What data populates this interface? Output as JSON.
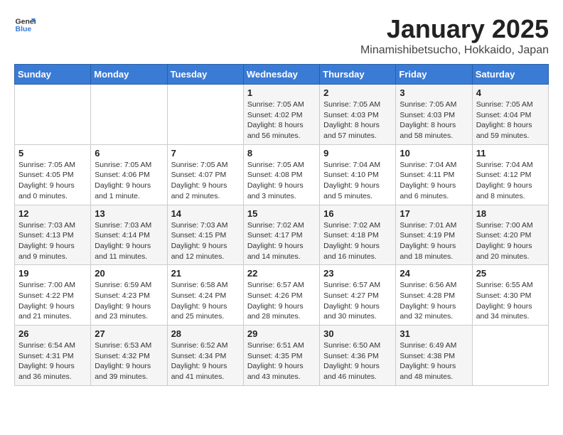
{
  "logo": {
    "line1": "General",
    "line2": "Blue"
  },
  "title": "January 2025",
  "subtitle": "Minamishibetsucho, Hokkaido, Japan",
  "weekdays": [
    "Sunday",
    "Monday",
    "Tuesday",
    "Wednesday",
    "Thursday",
    "Friday",
    "Saturday"
  ],
  "weeks": [
    [
      {
        "day": "",
        "info": ""
      },
      {
        "day": "",
        "info": ""
      },
      {
        "day": "",
        "info": ""
      },
      {
        "day": "1",
        "info": "Sunrise: 7:05 AM\nSunset: 4:02 PM\nDaylight: 8 hours\nand 56 minutes."
      },
      {
        "day": "2",
        "info": "Sunrise: 7:05 AM\nSunset: 4:03 PM\nDaylight: 8 hours\nand 57 minutes."
      },
      {
        "day": "3",
        "info": "Sunrise: 7:05 AM\nSunset: 4:03 PM\nDaylight: 8 hours\nand 58 minutes."
      },
      {
        "day": "4",
        "info": "Sunrise: 7:05 AM\nSunset: 4:04 PM\nDaylight: 8 hours\nand 59 minutes."
      }
    ],
    [
      {
        "day": "5",
        "info": "Sunrise: 7:05 AM\nSunset: 4:05 PM\nDaylight: 9 hours\nand 0 minutes."
      },
      {
        "day": "6",
        "info": "Sunrise: 7:05 AM\nSunset: 4:06 PM\nDaylight: 9 hours\nand 1 minute."
      },
      {
        "day": "7",
        "info": "Sunrise: 7:05 AM\nSunset: 4:07 PM\nDaylight: 9 hours\nand 2 minutes."
      },
      {
        "day": "8",
        "info": "Sunrise: 7:05 AM\nSunset: 4:08 PM\nDaylight: 9 hours\nand 3 minutes."
      },
      {
        "day": "9",
        "info": "Sunrise: 7:04 AM\nSunset: 4:10 PM\nDaylight: 9 hours\nand 5 minutes."
      },
      {
        "day": "10",
        "info": "Sunrise: 7:04 AM\nSunset: 4:11 PM\nDaylight: 9 hours\nand 6 minutes."
      },
      {
        "day": "11",
        "info": "Sunrise: 7:04 AM\nSunset: 4:12 PM\nDaylight: 9 hours\nand 8 minutes."
      }
    ],
    [
      {
        "day": "12",
        "info": "Sunrise: 7:03 AM\nSunset: 4:13 PM\nDaylight: 9 hours\nand 9 minutes."
      },
      {
        "day": "13",
        "info": "Sunrise: 7:03 AM\nSunset: 4:14 PM\nDaylight: 9 hours\nand 11 minutes."
      },
      {
        "day": "14",
        "info": "Sunrise: 7:03 AM\nSunset: 4:15 PM\nDaylight: 9 hours\nand 12 minutes."
      },
      {
        "day": "15",
        "info": "Sunrise: 7:02 AM\nSunset: 4:17 PM\nDaylight: 9 hours\nand 14 minutes."
      },
      {
        "day": "16",
        "info": "Sunrise: 7:02 AM\nSunset: 4:18 PM\nDaylight: 9 hours\nand 16 minutes."
      },
      {
        "day": "17",
        "info": "Sunrise: 7:01 AM\nSunset: 4:19 PM\nDaylight: 9 hours\nand 18 minutes."
      },
      {
        "day": "18",
        "info": "Sunrise: 7:00 AM\nSunset: 4:20 PM\nDaylight: 9 hours\nand 20 minutes."
      }
    ],
    [
      {
        "day": "19",
        "info": "Sunrise: 7:00 AM\nSunset: 4:22 PM\nDaylight: 9 hours\nand 21 minutes."
      },
      {
        "day": "20",
        "info": "Sunrise: 6:59 AM\nSunset: 4:23 PM\nDaylight: 9 hours\nand 23 minutes."
      },
      {
        "day": "21",
        "info": "Sunrise: 6:58 AM\nSunset: 4:24 PM\nDaylight: 9 hours\nand 25 minutes."
      },
      {
        "day": "22",
        "info": "Sunrise: 6:57 AM\nSunset: 4:26 PM\nDaylight: 9 hours\nand 28 minutes."
      },
      {
        "day": "23",
        "info": "Sunrise: 6:57 AM\nSunset: 4:27 PM\nDaylight: 9 hours\nand 30 minutes."
      },
      {
        "day": "24",
        "info": "Sunrise: 6:56 AM\nSunset: 4:28 PM\nDaylight: 9 hours\nand 32 minutes."
      },
      {
        "day": "25",
        "info": "Sunrise: 6:55 AM\nSunset: 4:30 PM\nDaylight: 9 hours\nand 34 minutes."
      }
    ],
    [
      {
        "day": "26",
        "info": "Sunrise: 6:54 AM\nSunset: 4:31 PM\nDaylight: 9 hours\nand 36 minutes."
      },
      {
        "day": "27",
        "info": "Sunrise: 6:53 AM\nSunset: 4:32 PM\nDaylight: 9 hours\nand 39 minutes."
      },
      {
        "day": "28",
        "info": "Sunrise: 6:52 AM\nSunset: 4:34 PM\nDaylight: 9 hours\nand 41 minutes."
      },
      {
        "day": "29",
        "info": "Sunrise: 6:51 AM\nSunset: 4:35 PM\nDaylight: 9 hours\nand 43 minutes."
      },
      {
        "day": "30",
        "info": "Sunrise: 6:50 AM\nSunset: 4:36 PM\nDaylight: 9 hours\nand 46 minutes."
      },
      {
        "day": "31",
        "info": "Sunrise: 6:49 AM\nSunset: 4:38 PM\nDaylight: 9 hours\nand 48 minutes."
      },
      {
        "day": "",
        "info": ""
      }
    ]
  ]
}
